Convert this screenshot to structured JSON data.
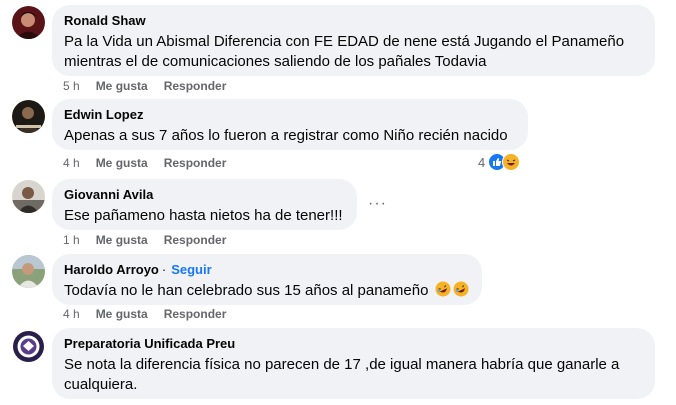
{
  "comments": [
    {
      "name": "Ronald Shaw",
      "text": "Pa la Vida un Abismal Diferencia con FE EDAD de nene está Jugando el Panameño mientras el de comunicaciones saliendo de los pañales Todavia",
      "time": "5 h",
      "like": "Me gusta",
      "reply": "Responder"
    },
    {
      "name": "Edwin Lopez",
      "text": "Apenas a sus 7 años lo fueron a registrar como Niño recién nacido",
      "time": "4 h",
      "like": "Me gusta",
      "reply": "Responder",
      "reaction_count": "4",
      "reaction_icons": [
        "like-icon",
        "haha-icon"
      ]
    },
    {
      "name": "Giovanni Avila",
      "text": "Ese pañameno hasta nietos ha de tener!!!",
      "time": "1 h",
      "like": "Me gusta",
      "reply": "Responder",
      "more": "···"
    },
    {
      "name": "Haroldo Arroyo",
      "separator": "·",
      "follow": "Seguir",
      "text": "Todavía no le han celebrado sus 15 años al panameño",
      "text_emojis": [
        "rolling-laughing-emoji",
        "rolling-laughing-emoji"
      ],
      "time": "4 h",
      "like": "Me gusta",
      "reply": "Responder"
    },
    {
      "name": "Preparatoria Unificada Preu",
      "text": "Se nota la diferencia física no parecen de 17 ,de igual manera habría que ganarle a cualquiera."
    }
  ],
  "colors": {
    "bubble": "#f0f2f5",
    "meta": "#65676b",
    "link": "#1877f2",
    "like": "#1877f2",
    "haha": "#f7b125"
  }
}
